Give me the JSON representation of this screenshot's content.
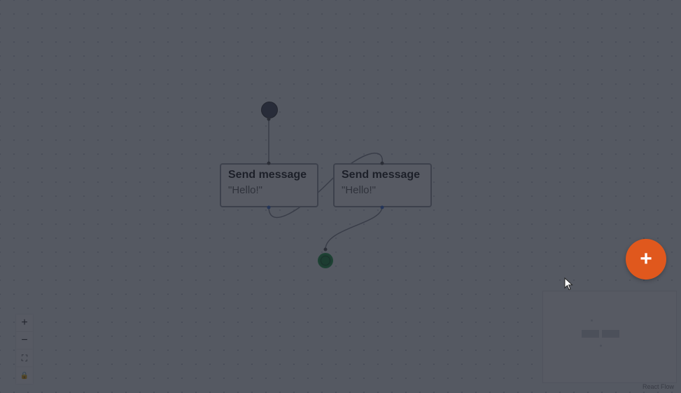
{
  "canvas": {
    "nodes": [
      {
        "id": "node-1",
        "title": "Send message",
        "message": "\"Hello!\""
      },
      {
        "id": "node-2",
        "title": "Send message",
        "message": "\"Hello!\""
      }
    ],
    "drag_count": "1"
  },
  "controls": {
    "zoom_in": "+",
    "zoom_out": "−",
    "fit_view": "⛶",
    "lock": "🔒"
  },
  "fab": {
    "label": "+"
  },
  "attribution": "React Flow",
  "colors": {
    "fab": "#e0581d",
    "end_node": "#1e8f3e",
    "start_node": "#4a4f5c",
    "overlay": "rgba(28,32,44,0.74)"
  }
}
